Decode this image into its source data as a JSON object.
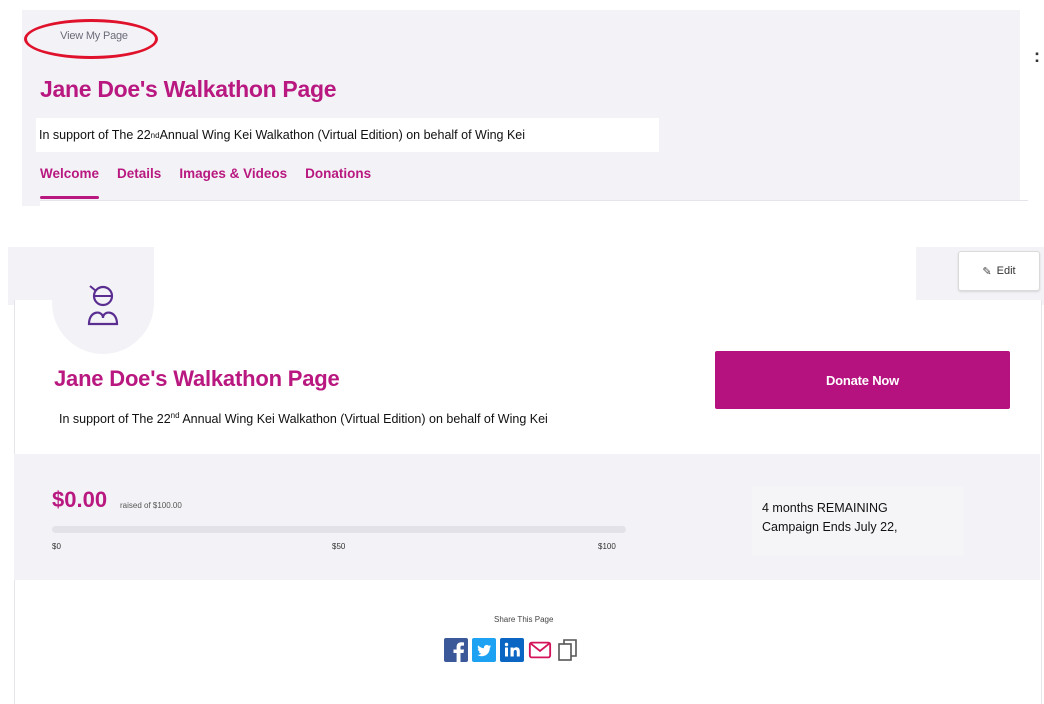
{
  "top": {
    "view_my_page": "View My Page",
    "kebab": ":",
    "title": "Jane Doe's Walkathon Page",
    "support_prefix": "In support of The 22",
    "support_sup": "nd",
    "support_suffix": " Annual Wing Kei Walkathon (Virtual Edition) on behalf of Wing Kei",
    "tabs": [
      "Welcome",
      "Details",
      "Images & Videos",
      "Donations"
    ]
  },
  "card": {
    "edit_label": "Edit",
    "title": "Jane Doe's Walkathon Page",
    "support_prefix": "In support of The 22",
    "support_sup": "nd",
    "support_suffix": " Annual Wing Kei Walkathon (Virtual Edition) on behalf of Wing Kei",
    "donate_label": "Donate Now"
  },
  "progress": {
    "raised": "$0.00",
    "raised_of": "raised of $100.00",
    "fraction": 0,
    "ticks": [
      "$0",
      "$50",
      "$100"
    ]
  },
  "campaign": {
    "remaining": "4 months REMAINING",
    "ends": "Campaign Ends July 22,"
  },
  "share": {
    "label": "Share This Page",
    "icons": [
      "facebook-icon",
      "twitter-icon",
      "linkedin-icon",
      "email-icon",
      "copy-icon"
    ]
  },
  "colors": {
    "brand": "#b8187f",
    "donate": "#b5117f",
    "facebook": "#3b5998",
    "twitter": "#1da1f2",
    "linkedin": "#0a66c2",
    "email": "#d4145a",
    "highlight": "#e0112b"
  }
}
